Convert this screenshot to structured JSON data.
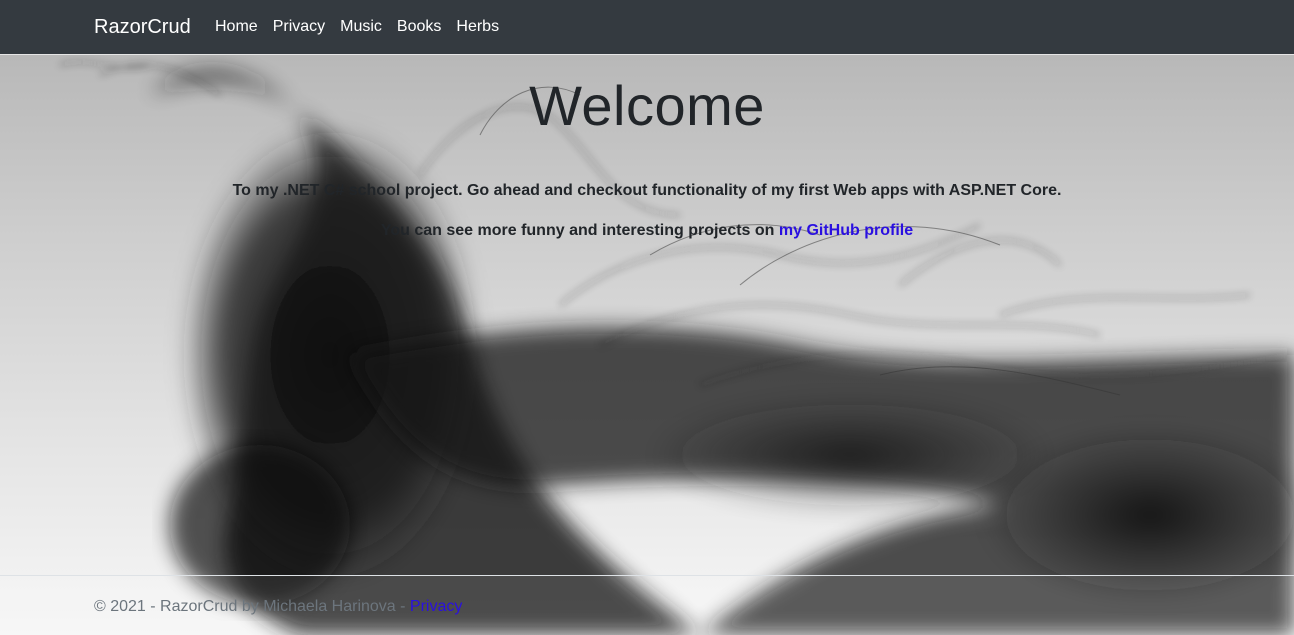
{
  "navbar": {
    "brand": "RazorCrud",
    "links": [
      "Home",
      "Privacy",
      "Music",
      "Books",
      "Herbs"
    ],
    "background": "#343a40"
  },
  "main": {
    "title": "Welcome",
    "intro": "To my .NET C# school project. Go ahead and checkout functionality of my first Web apps with ASP.NET Core.",
    "more_prefix": "You can see more funny and interesting projects on ",
    "github_link": "my GitHub profile"
  },
  "footer": {
    "text": "© 2021 - RazorCrud by Michaela Harinova - ",
    "privacy_link": "Privacy"
  },
  "colors": {
    "link": "#2a10e0",
    "text": "#212529",
    "footer_text": "#6c757d"
  },
  "background_image": "black-ink-smoke"
}
